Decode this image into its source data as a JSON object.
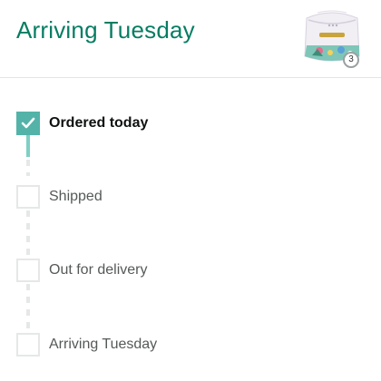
{
  "header": {
    "title": "Arriving Tuesday",
    "product_image_icon": "diaper-package-thumbnail",
    "quantity": "3"
  },
  "tracking": {
    "accent_color": "#067d62",
    "progress_color": "#53b3a8",
    "steps": [
      {
        "label": "Ordered today",
        "status": "complete",
        "icon": "checkmark-icon"
      },
      {
        "label": "Shipped",
        "status": "pending"
      },
      {
        "label": "Out for delivery",
        "status": "pending"
      },
      {
        "label": "Arriving Tuesday",
        "status": "pending"
      }
    ]
  }
}
